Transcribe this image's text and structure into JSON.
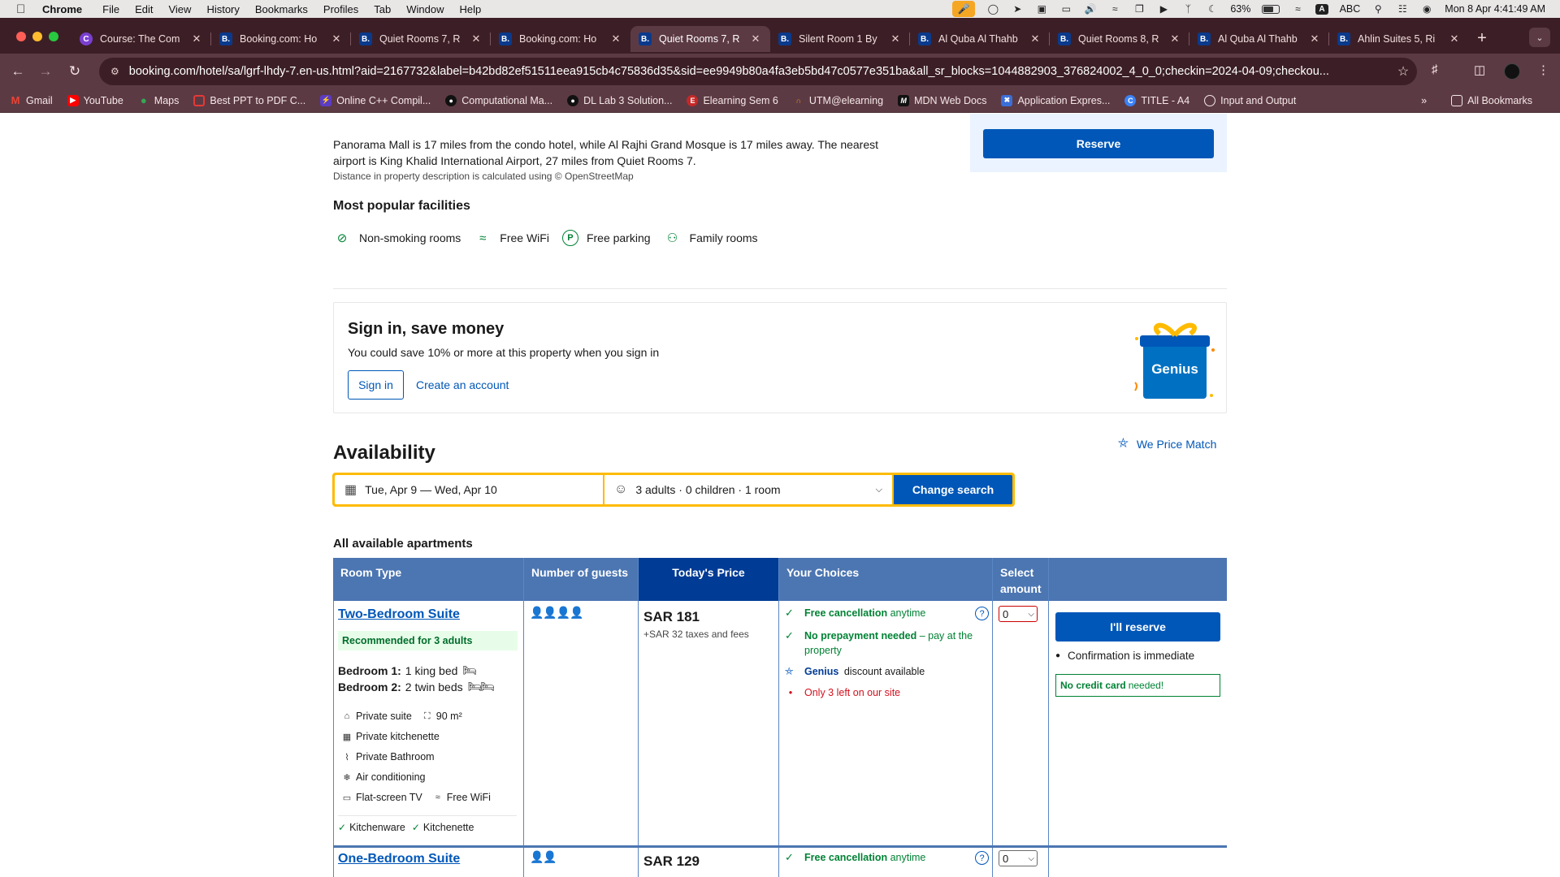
{
  "menubar": {
    "app": "Chrome",
    "items": [
      "File",
      "Edit",
      "View",
      "History",
      "Bookmarks",
      "Profiles",
      "Tab",
      "Window",
      "Help"
    ],
    "battery": "63%",
    "input_source": "ABC",
    "datetime": "Mon 8 Apr  4:41:49 AM"
  },
  "tabs": [
    {
      "title": "Course: The Com",
      "favicon": "course-icon",
      "active": false
    },
    {
      "title": "Booking.com: Ho",
      "favicon": "booking-icon",
      "active": false
    },
    {
      "title": "Quiet Rooms 7, R",
      "favicon": "booking-icon",
      "active": false
    },
    {
      "title": "Booking.com: Ho",
      "favicon": "booking-icon",
      "active": false
    },
    {
      "title": "Quiet Rooms 7, R",
      "favicon": "booking-icon",
      "active": true
    },
    {
      "title": "Silent Room 1 By",
      "favicon": "booking-icon",
      "active": false
    },
    {
      "title": "Al Quba Al Thahb",
      "favicon": "booking-icon",
      "active": false
    },
    {
      "title": "Quiet Rooms 8, R",
      "favicon": "booking-icon",
      "active": false
    },
    {
      "title": "Al Quba Al Thahb",
      "favicon": "booking-icon",
      "active": false
    },
    {
      "title": "Ahlin Suites 5, Ri",
      "favicon": "booking-icon",
      "active": false
    }
  ],
  "address_bar": {
    "url": "booking.com/hotel/sa/lgrf-lhdy-7.en-us.html?aid=2167732&label=b42bd82ef51511eea915cb4c75836d35&sid=ee9949b80a4fa3eb5bd47c0577e351ba&all_sr_blocks=1044882903_376824002_4_0_0;checkin=2024-04-09;checkou..."
  },
  "bookmarks": [
    {
      "label": "Gmail",
      "icon": "gmail-icon"
    },
    {
      "label": "YouTube",
      "icon": "youtube-icon"
    },
    {
      "label": "Maps",
      "icon": "maps-icon"
    },
    {
      "label": "Best PPT to PDF C...",
      "icon": "pdf-icon"
    },
    {
      "label": "Online C++ Compil...",
      "icon": "compiler-icon"
    },
    {
      "label": "Computational Ma...",
      "icon": "github-icon"
    },
    {
      "label": "DL Lab 3 Solution...",
      "icon": "github-icon"
    },
    {
      "label": "Elearning Sem 6",
      "icon": "elearning-icon"
    },
    {
      "label": "UTM@elearning",
      "icon": "utm-icon"
    },
    {
      "label": "MDN Web Docs",
      "icon": "mdn-icon"
    },
    {
      "label": "Application Expres...",
      "icon": "apex-icon"
    },
    {
      "label": "TITLE - A4",
      "icon": "canva-icon"
    },
    {
      "label": "Input and Output",
      "icon": "globe-icon"
    }
  ],
  "bookmarks_all": "All Bookmarks",
  "reserve_top": "Reserve",
  "description": {
    "text": "Panorama Mall is 17 miles from the condo hotel, while Al Rajhi Grand Mosque is 17 miles away. The nearest airport is King Khalid International Airport, 27 miles from Quiet Rooms 7.",
    "note": "Distance in property description is calculated using © OpenStreetMap"
  },
  "facilities": {
    "title": "Most popular facilities",
    "items": [
      {
        "label": "Non-smoking rooms",
        "icon": "no-smoking-icon"
      },
      {
        "label": "Free WiFi",
        "icon": "wifi-icon"
      },
      {
        "label": "Free parking",
        "icon": "parking-icon"
      },
      {
        "label": "Family rooms",
        "icon": "family-icon"
      }
    ]
  },
  "signin": {
    "title": "Sign in, save money",
    "subtitle": "You could save 10% or more at this property when you sign in",
    "sign_in": "Sign in",
    "create": "Create an account",
    "genius_label": "Genius"
  },
  "availability": {
    "title": "Availability",
    "price_match": "We Price Match",
    "dates": "Tue, Apr 9  —  Wed, Apr 10",
    "guests": "3 adults · 0 children · 1 room",
    "change_search": "Change search"
  },
  "apartments": {
    "title": "All available apartments",
    "headers": {
      "room_type": "Room Type",
      "guests": "Number of guests",
      "price": "Today's Price",
      "choices": "Your Choices",
      "select": "Select amount"
    },
    "rows": [
      {
        "name": "Two-Bedroom Suite",
        "recommended": "Recommended for 3 adults",
        "bedroom1_label": "Bedroom 1:",
        "bedroom1_beds": "1 king bed",
        "bedroom2_label": "Bedroom 2:",
        "bedroom2_beds": "2 twin beds",
        "amenities": {
          "private_suite": "Private suite",
          "size": "90 m²",
          "kitchenette": "Private kitchenette",
          "bathroom": "Private Bathroom",
          "ac": "Air conditioning",
          "tv": "Flat-screen TV",
          "wifi": "Free WiFi"
        },
        "extras": [
          "Kitchenware",
          "Kitchenette"
        ],
        "guests": 4,
        "price": "SAR 181",
        "taxes": "+SAR 32 taxes and fees",
        "choices": {
          "cancel_bold": "Free cancellation",
          "cancel_rest": " anytime",
          "prepay_bold": "No prepayment needed",
          "prepay_rest": " – pay at the property",
          "genius_word": "Genius",
          "genius_rest": " discount available",
          "scarcity": "Only 3 left on our site"
        },
        "selected_amount": "0",
        "reserve": "I'll reserve",
        "confirmation": "Confirmation is immediate",
        "no_cc_bold": "No credit card",
        "no_cc_rest": " needed!"
      },
      {
        "name": "One-Bedroom Suite",
        "guests": 2,
        "price": "SAR 129",
        "choices": {
          "cancel_bold": "Free cancellation",
          "cancel_rest": " anytime"
        },
        "selected_amount": "0"
      }
    ]
  },
  "colors": {
    "brand_blue": "#003b95",
    "link_blue": "#0057b8",
    "header_blue": "#4c76b2",
    "search_yellow": "#febb02",
    "green": "#008234",
    "red": "#d4111e"
  }
}
